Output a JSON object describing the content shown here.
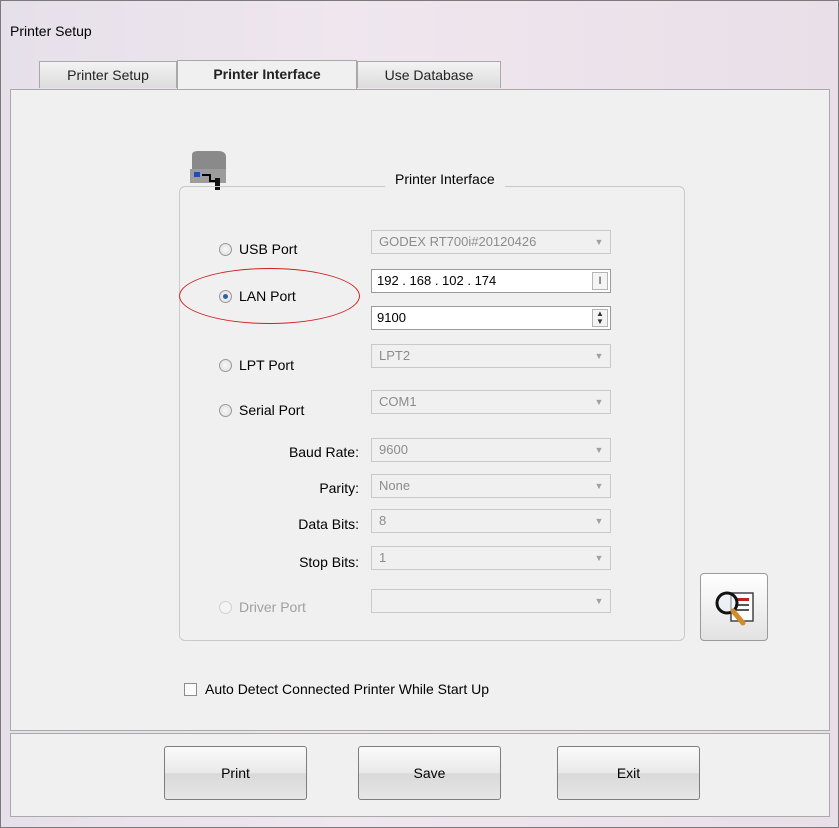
{
  "window": {
    "title": "Printer Setup"
  },
  "tabs": [
    {
      "label": "Printer Setup"
    },
    {
      "label": "Printer Interface"
    },
    {
      "label": "Use Database"
    }
  ],
  "group": {
    "title": "Printer Interface"
  },
  "usb": {
    "label": "USB Port",
    "value": "GODEX RT700i#20120426"
  },
  "lan": {
    "label": "LAN Port",
    "ip": "192 . 168 . 102 . 174",
    "port": "9100"
  },
  "lpt": {
    "label": "LPT Port",
    "value": "LPT2"
  },
  "serial": {
    "label": "Serial Port",
    "value": "COM1",
    "baud_label": "Baud Rate:",
    "baud": "9600",
    "parity_label": "Parity:",
    "parity": "None",
    "databits_label": "Data Bits:",
    "databits": "8",
    "stopbits_label": "Stop Bits:",
    "stopbits": "1"
  },
  "driver": {
    "label": "Driver Port",
    "value": ""
  },
  "auto_detect": {
    "label": "Auto Detect Connected Printer While Start Up",
    "checked": false
  },
  "buttons": {
    "print": "Print",
    "save": "Save",
    "exit": "Exit"
  },
  "icons": {
    "printer": "printer-icon",
    "search": "search-printer-icon",
    "cursor": "text-cursor-icon",
    "spinner": "spinner-icon",
    "dropdown": "chevron-down-icon"
  },
  "colors": {
    "annotation": "#d02020",
    "radio_selected": "#2d5fa8"
  }
}
